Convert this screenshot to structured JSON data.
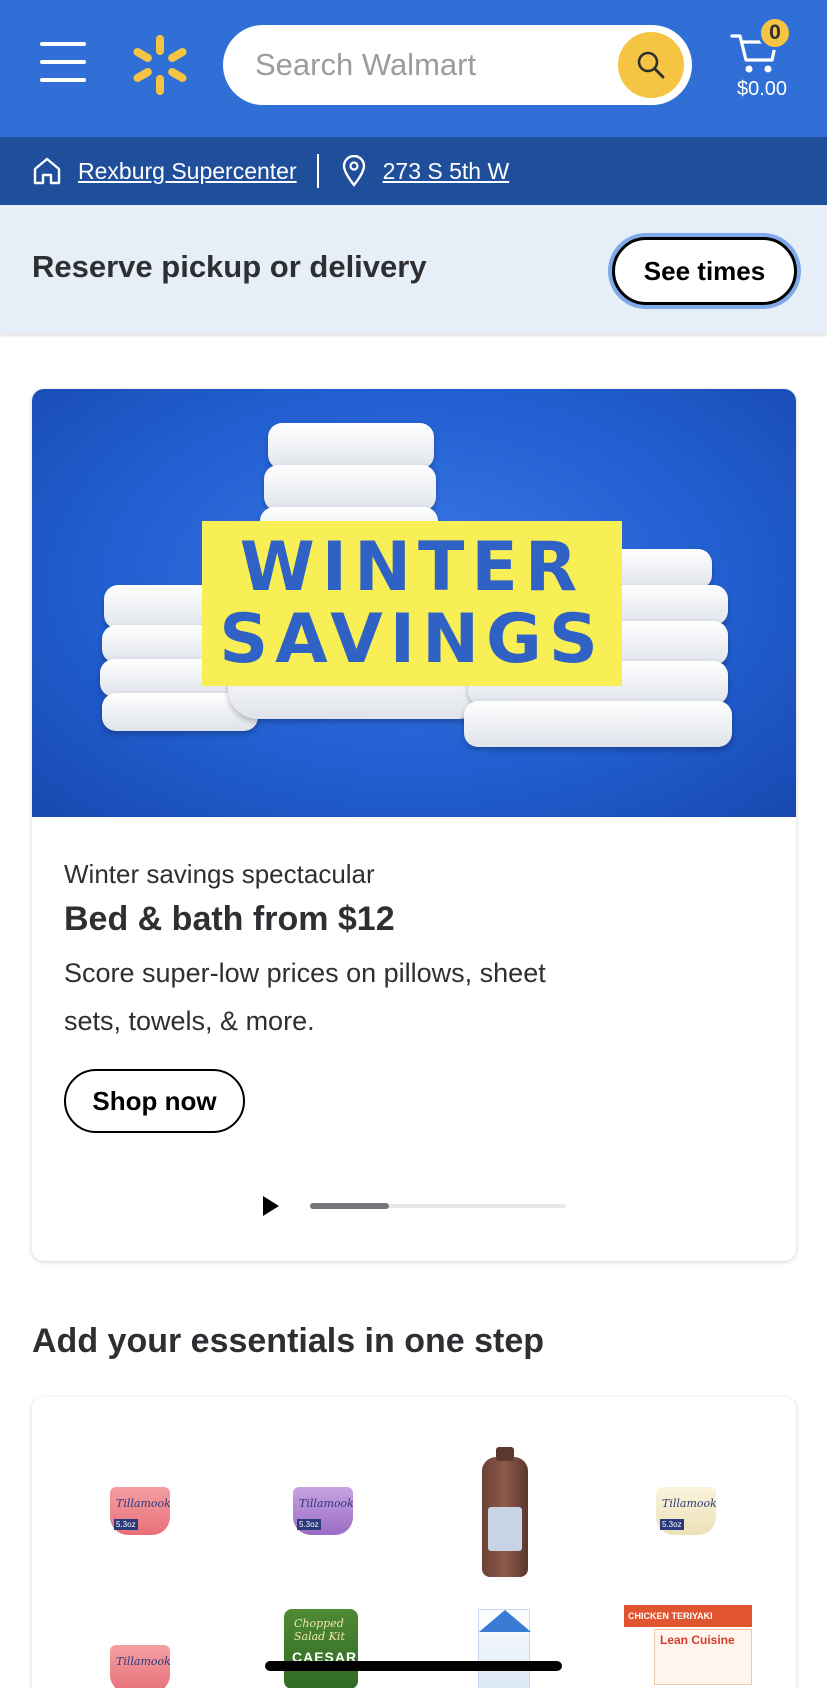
{
  "header": {
    "search_placeholder": "Search Walmart",
    "cart_count": "0",
    "cart_total": "$0.00"
  },
  "store_bar": {
    "store_name": "Rexburg Supercenter",
    "address": "273 S 5th W"
  },
  "reserve": {
    "text": "Reserve pickup or delivery",
    "button": "See times"
  },
  "promo": {
    "hero_line1": "WINTER",
    "hero_line2": "SAVINGS",
    "eyebrow": "Winter savings spectacular",
    "headline": "Bed & bath from $12",
    "description": "Score super-low prices on pillows, sheet sets, towels, & more.",
    "button": "Shop now",
    "carousel_progress": 0.31
  },
  "essentials": {
    "title": "Add your essentials in one step",
    "products": [
      {
        "brand": "Tillamook",
        "size": "5.3oz"
      },
      {
        "brand": "Tillamook",
        "size": "5.3oz"
      },
      {
        "brand": "",
        "size": ""
      },
      {
        "brand": "Tillamook",
        "size": "5.3oz"
      },
      {
        "brand": "Tillamook",
        "size": ""
      },
      {
        "brand": "Chopped Salad Kit",
        "size": "CAESAR"
      },
      {
        "brand": "",
        "size": ""
      },
      {
        "brand": "CHICKEN TERIYAKI",
        "size": "Lean Cuisine"
      }
    ]
  },
  "colors": {
    "brand_blue": "#2f6fd6",
    "store_bar": "#1f4f9b",
    "spark_yellow": "#f6c443"
  }
}
